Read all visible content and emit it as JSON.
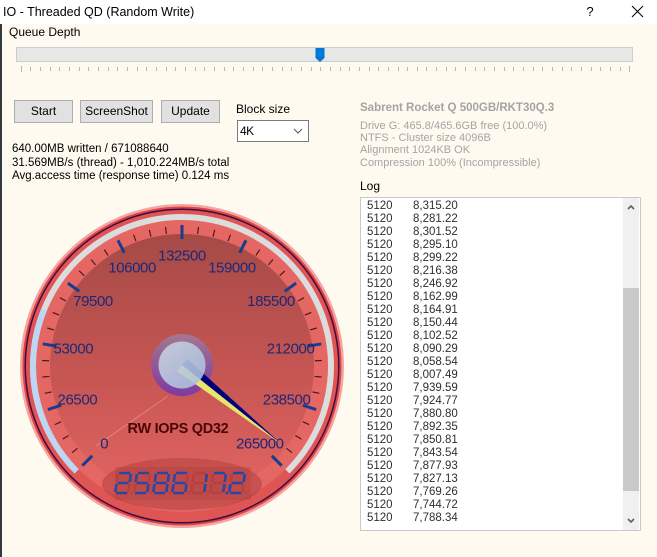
{
  "window": {
    "title": "IO - Threaded QD (Random Write)",
    "help_label": "?",
    "close_icon": "close-x-icon"
  },
  "queue_depth": {
    "label": "Queue Depth",
    "min": 1,
    "max": 64,
    "value": 32
  },
  "toolbar": {
    "start_label": "Start",
    "screenshot_label": "ScreenShot",
    "update_label": "Update"
  },
  "block_size": {
    "label": "Block size",
    "value": "4K"
  },
  "stats": {
    "written": "640.00MB written / 671088640",
    "throughput": "31.569MB/s (thread) - 1,010.224MB/s total",
    "access_time": "Avg.access time (response time) 0.124 ms"
  },
  "drive": {
    "name": "Sabrent Rocket Q 500GB/RKT30Q.3",
    "lines": [
      "Drive G: 465.8/465.6GB free (100.0%)",
      "NTFS - Cluster size 4096B",
      "Alignment 1024KB OK",
      "Compression 100% (Incompressible)"
    ]
  },
  "log": {
    "label": "Log",
    "scroll": {
      "visible_fraction": 0.68,
      "position": 0.77
    },
    "rows": [
      {
        "size": "5120",
        "value": "8,315.20"
      },
      {
        "size": "5120",
        "value": "8,281.22"
      },
      {
        "size": "5120",
        "value": "8,301.52"
      },
      {
        "size": "5120",
        "value": "8,295.10"
      },
      {
        "size": "5120",
        "value": "8,299.22"
      },
      {
        "size": "5120",
        "value": "8,216.38"
      },
      {
        "size": "5120",
        "value": "8,246.92"
      },
      {
        "size": "5120",
        "value": "8,162.99"
      },
      {
        "size": "5120",
        "value": "8,164.91"
      },
      {
        "size": "5120",
        "value": "8,150.44"
      },
      {
        "size": "5120",
        "value": "8,102.52"
      },
      {
        "size": "5120",
        "value": "8,090.29"
      },
      {
        "size": "5120",
        "value": "8,058.54"
      },
      {
        "size": "5120",
        "value": "8,007.49"
      },
      {
        "size": "5120",
        "value": "7,939.59"
      },
      {
        "size": "5120",
        "value": "7,924.77"
      },
      {
        "size": "5120",
        "value": "7,880.80"
      },
      {
        "size": "5120",
        "value": "7,892.35"
      },
      {
        "size": "5120",
        "value": "7,850.81"
      },
      {
        "size": "5120",
        "value": "7,843.54"
      },
      {
        "size": "5120",
        "value": "7,877.93"
      },
      {
        "size": "5120",
        "value": "7,827.13"
      },
      {
        "size": "5120",
        "value": "7,769.26"
      },
      {
        "size": "5120",
        "value": "7,744.72"
      },
      {
        "size": "5120",
        "value": "7,788.34"
      }
    ]
  },
  "gauge": {
    "title": "RW IOPS QD32",
    "min": 0,
    "max": 265000,
    "major_step": 26500,
    "minor_divisions": 4,
    "value": 258617.2,
    "display": "258617.2",
    "band": {
      "from": 0,
      "to": 66000
    },
    "tick_labels": [
      "0",
      "26500",
      "53000",
      "79500",
      "106000",
      "132500",
      "159000",
      "185500",
      "212000",
      "238500",
      "265000"
    ],
    "colors": {
      "major_tick": "#1a3c8c",
      "minor_tick": "#4a1a1a",
      "label": "#1e2878",
      "title": "#4a0606",
      "track": "#dcdcdc",
      "band": "#bcd6f3",
      "needle_primary": "#00007a",
      "needle_secondary": "#e6e66e",
      "digits": "#2846a6"
    }
  },
  "colors": {
    "accent": "#0078d7",
    "window_bg": "#fefaef",
    "muted_text": "#a4a4a4"
  }
}
